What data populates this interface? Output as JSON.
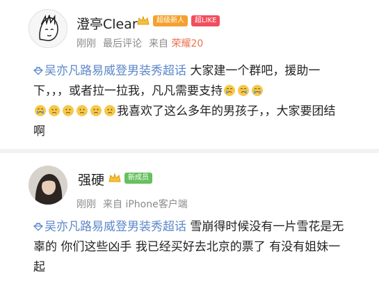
{
  "posts": [
    {
      "username": "澄亭Clear",
      "badges": [
        "超级新人",
        "超LIKE"
      ],
      "time": "刚刚",
      "label": "最后评论",
      "source_prefix": "来自",
      "source": "荣耀20",
      "topic": "吴亦凡路易威登男装秀超话",
      "text_a": " 大家建一个群吧，援助一下，，，或者拉一拉我，凡凡需要支持",
      "text_b": "我喜欢了这么多年的男孩子，，大家要团结啊"
    },
    {
      "username": "强硬",
      "badges": [
        "新成员"
      ],
      "time": "刚刚",
      "source_prefix": "来自",
      "source": "iPhone客户端",
      "topic": "吴亦凡路易威登男装秀超话",
      "text": " 雪崩得时候没有一片雪花是无辜的 你们这些凶手 我已经买好去北京的票了 有没有姐妹一起"
    }
  ],
  "colors": {
    "topic_blue": "#5b87c9",
    "badge_orange": "#f5a12e",
    "badge_red": "#f24d5c",
    "badge_green": "#66c05f",
    "source_orange": "#eb7350"
  },
  "icons": {
    "topic": "diamond-topic-icon",
    "vip": "vip-crown-icon",
    "crying_emoji": "crying-emoji",
    "sad_emoji": "sad-emoji"
  }
}
